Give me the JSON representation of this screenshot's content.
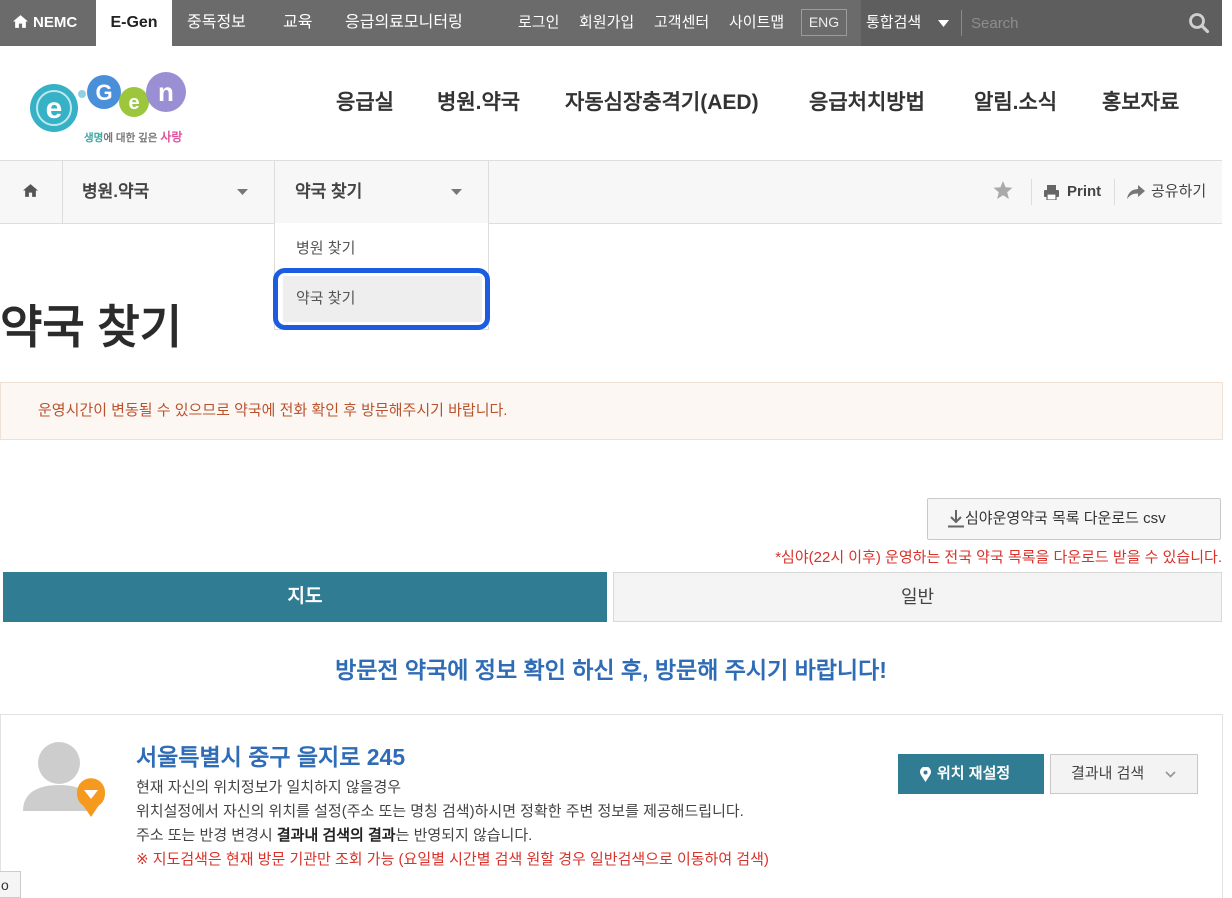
{
  "topbar": {
    "home_label": "NEMC",
    "tabs": [
      {
        "label": "E-Gen",
        "active": true
      },
      {
        "label": "중독정보"
      },
      {
        "label": "교육"
      },
      {
        "label": "응급의료모니터링"
      }
    ],
    "util_links": [
      "로그인",
      "회원가입",
      "고객센터",
      "사이트맵"
    ],
    "lang_button": "ENG",
    "search_scope": "통합검색",
    "search_placeholder": "Search"
  },
  "header": {
    "logo": {
      "letters": [
        "e",
        "G",
        "e",
        "n"
      ],
      "tagline": [
        "생명",
        "에 대한 깊은 ",
        "사랑"
      ]
    },
    "nav": [
      "응급실",
      "병원.약국",
      "자동심장충격기(AED)",
      "응급처치방법",
      "알림.소식",
      "홍보자료"
    ]
  },
  "breadcrumb": {
    "level1": "병원.약국",
    "level2": "약국 찾기",
    "dropdown": [
      "병원 찾기",
      "약국 찾기"
    ],
    "dropdown_selected": "약국 찾기",
    "print_label": "Print",
    "share_label": "공유하기"
  },
  "page": {
    "title": "약국 찾기",
    "notice": "운영시간이 변동될 수 있으므로 약국에 전화 확인 후 방문해주시기 바랍니다.",
    "download_label": "심야운영약국 목록 다운로드 csv",
    "download_note": "*심야(22시 이후) 운영하는 전국 약국 목록을 다운로드 받을 수 있습니다.",
    "tabs": [
      {
        "label": "지도",
        "active": true
      },
      {
        "label": "일반",
        "active": false
      }
    ],
    "visit_heading": "방문전 약국에 정보 확인 하신 후, 방문해 주시기 바랍니다!"
  },
  "location": {
    "address": "서울특별시 중구 을지로 245",
    "line1": "현재 자신의 위치정보가 일치하지 않을경우",
    "line2": "위치설정에서 자신의 위치를 설정(주소 또는 명칭 검색)하시면 정확한 주변 정보를 제공해드립니다.",
    "line3_pre": "주소 또는 반경 변경시 ",
    "line3_bold": "결과내 검색의 결과",
    "line3_post": "는 반영되지 않습니다.",
    "warning": "※ 지도검색은 현재 방문 기관만 조회 가능 (요일별 시간별 검색 원할 경우 일반검색으로 이동하여 검색)",
    "reset_button": "위치 재설정",
    "filter_button": "결과내 검색"
  },
  "corner_widget": "o",
  "icons": {
    "topbar_home": "home-icon",
    "search_scope_caret": "caret-down-icon",
    "search": "search-icon",
    "breadcrumb_home": "home-icon",
    "breadcrumb_caret": "caret-down-icon",
    "favorite": "star-icon",
    "print": "printer-icon",
    "share": "share-icon",
    "download": "download-icon",
    "avatar": "user-avatar-icon",
    "avatar_badge": "location-pin-icon",
    "reset_location": "map-marker-icon",
    "filter_toggle": "chevron-down-icon"
  },
  "colors": {
    "topbar": "#6b6b6b",
    "search_bg": "#5e5e5e",
    "accent": "#2f7c93",
    "heading_blue": "#2f6cb6",
    "alert_red": "#d9322b",
    "notice_text": "#b9532e",
    "highlight": "#1b5ce0"
  }
}
